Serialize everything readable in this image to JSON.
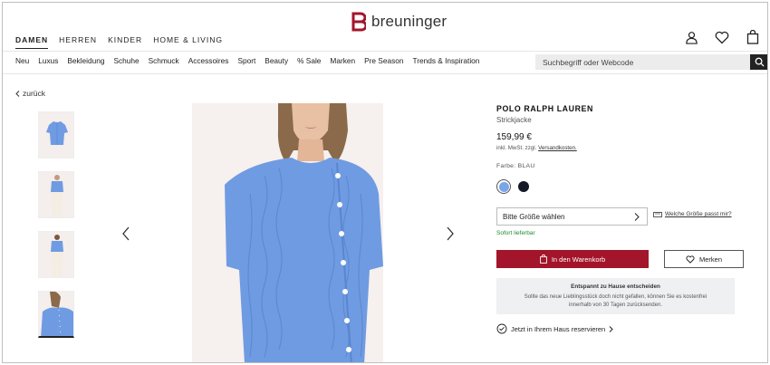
{
  "brand": {
    "logo_text": "breuninger",
    "accent": "#a3152a"
  },
  "main_nav": [
    "DAMEN",
    "HERREN",
    "KINDER",
    "HOME & LIVING"
  ],
  "main_nav_active": "DAMEN",
  "header_icons": [
    "user-icon",
    "heart-icon",
    "bag-icon"
  ],
  "category_nav": [
    "Neu",
    "Luxus",
    "Bekleidung",
    "Schuhe",
    "Schmuck",
    "Accessoires",
    "Sport",
    "Beauty",
    "% Sale",
    "Marken",
    "Pre Season",
    "Trends & Inspiration"
  ],
  "search": {
    "placeholder": "Suchbegriff oder Webcode",
    "icon": "search-icon"
  },
  "back_link": "zurück",
  "gallery": {
    "thumbnail_count": 4,
    "active_index": 3
  },
  "product": {
    "brand": "POLO RALPH LAUREN",
    "type": "Strickjacke",
    "price": "159,99 €",
    "vat_prefix": "inkl. MwSt. zzgl.",
    "vat_link": "Versandkosten.",
    "color_label": "Farbe: BLAU",
    "colors": [
      "#7aa5e8",
      "#151826"
    ],
    "selected_color_index": 0,
    "size_placeholder": "Bitte Größe wählen",
    "size_help": "Welche Größe passt mir?",
    "stock_status": "Sofort lieferbar",
    "add_to_cart": "In den Warenkorb",
    "wishlist": "Merken"
  },
  "info_box": {
    "title": "Entspannt zu Hause entscheiden",
    "text_line1": "Sollte das neue Lieblingsstück doch nicht gefallen, können Sie es kostenfrei",
    "text_line2": "innerhalb von 30 Tagen zurücksenden."
  },
  "reserve": "Jetzt in Ihrem Haus reservieren"
}
